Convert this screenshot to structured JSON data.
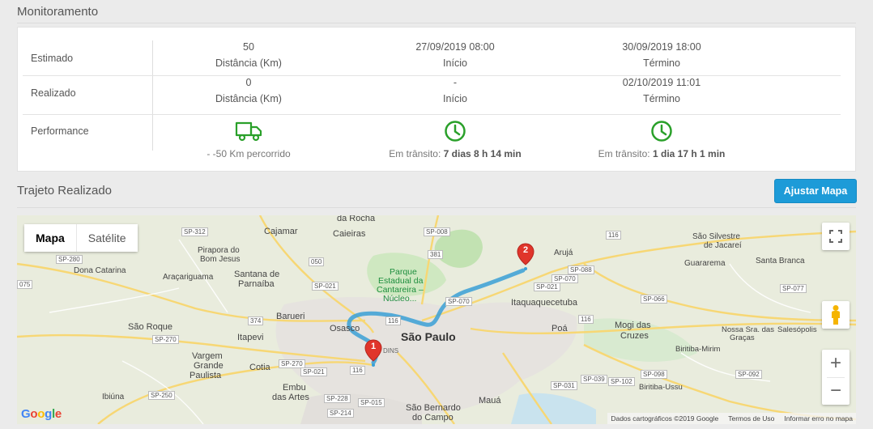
{
  "monitoramento": {
    "title": "Monitoramento",
    "estimado": {
      "label": "Estimado",
      "distance": "50",
      "distance_label": "Distância (Km)",
      "start": "27/09/2019 08:00",
      "start_label": "Início",
      "end": "30/09/2019 18:00",
      "end_label": "Término"
    },
    "realizado": {
      "label": "Realizado",
      "distance": "0",
      "distance_label": "Distância (Km)",
      "start": "-",
      "start_label": "Início",
      "end": "02/10/2019 11:01",
      "end_label": "Término"
    },
    "performance": {
      "label": "Performance",
      "distance_text": "- -50 Km percorrido",
      "transit_prefix": "Em trânsito:",
      "transit1": "7 dias 8 h 14 min",
      "transit2": "1 dia 17 h 1 min",
      "truck_color": "#2aa02a",
      "clock_color": "#2aa02a"
    }
  },
  "trajeto": {
    "title": "Trajeto Realizado",
    "button_label": "Ajustar Mapa"
  },
  "map": {
    "type_map": "Mapa",
    "type_satellite": "Satélite",
    "zoom_in": "+",
    "zoom_out": "−",
    "marker1": "1",
    "marker2": "2",
    "footer_data": "Dados cartográficos ©2019 Google",
    "footer_terms": "Termos de Uso",
    "footer_report": "Informar erro no mapa",
    "labels": {
      "da_rocha": "da Rocha",
      "cajamar": "Cajamar",
      "caieiras": "Caieiras",
      "pirapora": "Pirapora do",
      "bom_jesus": "Bom Jesus",
      "dona_catarina": "Dona Catarina",
      "aracariguama": "Araçariguama",
      "santana": "Santana de",
      "parnaiba": "Parnaíba",
      "parque1": "Parque",
      "parque2": "Estadual da",
      "parque3": "Cantareira –",
      "parque4": "Núcleo...",
      "aruja": "Arujá",
      "sao_silvestre": "São Silvestre",
      "de_jacarei": "de Jacareí",
      "guararema": "Guararema",
      "santa_branca": "Santa Branca",
      "itaquaquecetuba": "Itaquaquecetuba",
      "barueri": "Barueri",
      "sao_roque": "São Roque",
      "osasco": "Osasco",
      "sao_paulo": "São Paulo",
      "itapevi": "Itapevi",
      "poa": "Poá",
      "mogi1": "Mogi das",
      "mogi2": "Cruzes",
      "nossa1": "Nossa Sra. das",
      "nossa2": "Graças",
      "salesopolis": "Salesópolis",
      "vargem1": "Vargem",
      "vargem2": "Grande",
      "vargem3": "Paulista",
      "cotia": "Cotia",
      "biritiba": "Biritiba-Mirim",
      "embu1": "Embu",
      "embu2": "das Artes",
      "maua": "Mauá",
      "sbc1": "São Bernardo",
      "sbc2": "do Campo",
      "ibiuna": "Ibiúna",
      "biritiba_ussu": "Biritiba-Ussu",
      "dins": "DINS"
    },
    "shields": {
      "sp312": "SP-312",
      "sp280": "SP-280",
      "n075": "075",
      "sp008": "SP-008",
      "r381": "381",
      "r050": "050",
      "sp021a": "SP-021",
      "r116a": "116",
      "r374": "374",
      "sp270a": "SP-270",
      "sp088": "SP-088",
      "sp070a": "SP-070",
      "sp021b": "SP-021",
      "sp077": "SP-077",
      "sp066": "SP-066",
      "r116b": "116",
      "sp070b": "SP-070",
      "r116c": "116",
      "sp270b": "SP-270",
      "sp021c": "SP-021",
      "sp250": "SP-250",
      "sp228": "SP-228",
      "sp015": "SP-015",
      "sp214": "SP-214",
      "sp039": "SP-039",
      "sp102": "SP-102",
      "sp098": "SP-098",
      "sp092": "SP-092",
      "sp031": "SP-031",
      "r116d": "116"
    },
    "route_color": "#3aa0d6",
    "marker_color": "#e0352b"
  }
}
